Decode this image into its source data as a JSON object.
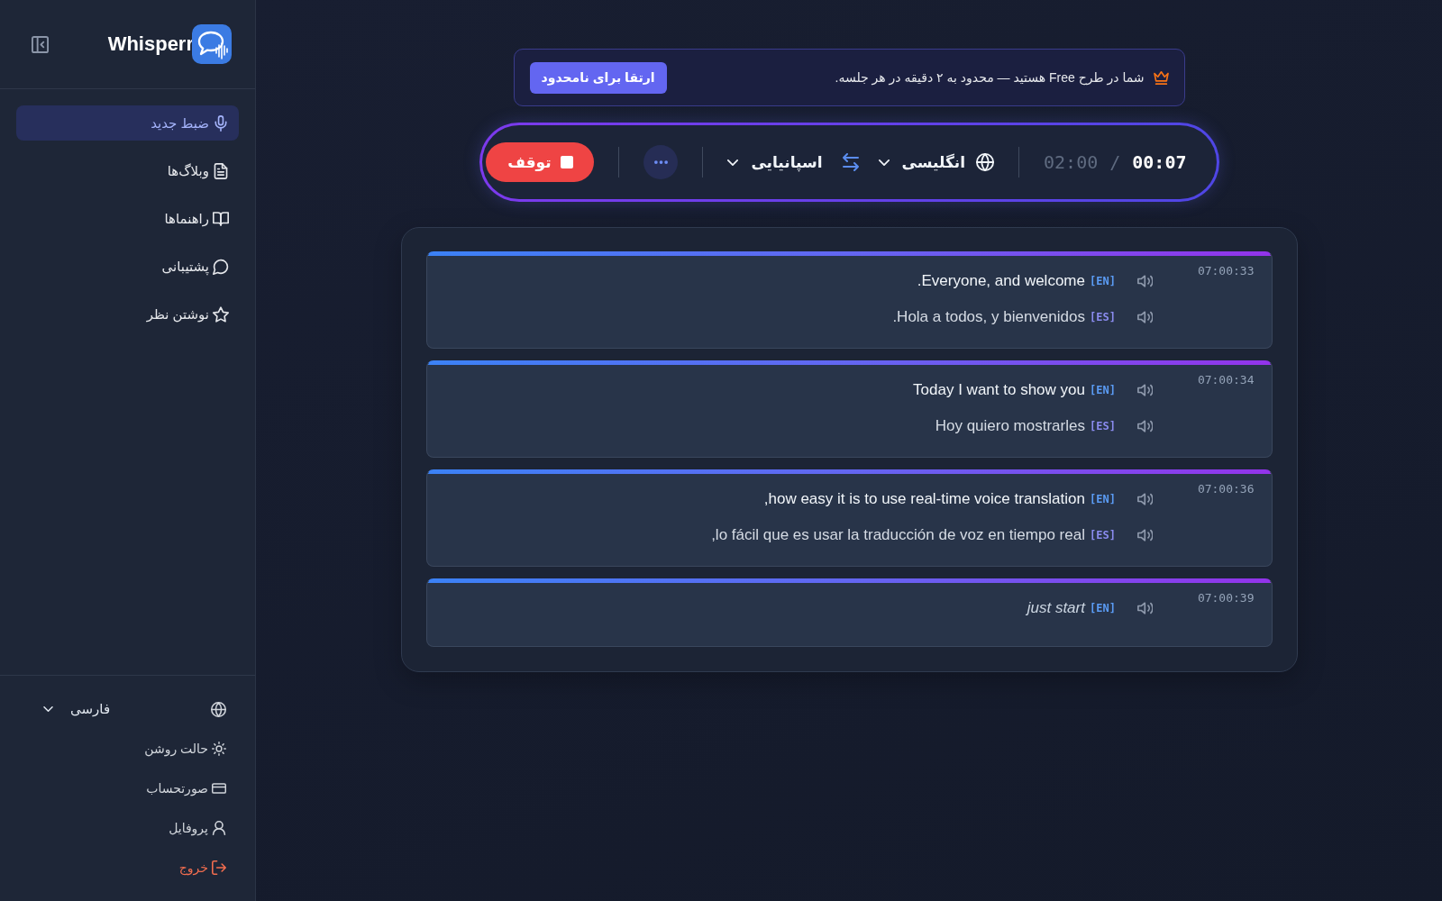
{
  "sidebar": {
    "logo_text": "Whisperr",
    "nav": [
      {
        "label": "ضبط جدید",
        "selected": true
      },
      {
        "label": "وبلاگ‌ها",
        "selected": false
      },
      {
        "label": "راهنماها",
        "selected": false
      },
      {
        "label": "پشتیبانی",
        "selected": false
      },
      {
        "label": "نوشتن نظر",
        "selected": false
      }
    ],
    "language": "فارسی",
    "footer": [
      {
        "label": "حالت روشن",
        "kind": "normal"
      },
      {
        "label": "صورتحساب",
        "kind": "normal"
      },
      {
        "label": "پروفایل",
        "kind": "normal"
      },
      {
        "label": "خروج",
        "kind": "danger"
      }
    ]
  },
  "banner": {
    "text": "شما در طرح Free هستید — محدود به ۲ دقیقه در هر جلسه.",
    "button": "ارتقا برای نامحدود"
  },
  "recorder": {
    "elapsed": "00:07",
    "separator": "/",
    "limit": "02:00",
    "source_language": "انگلیسی",
    "target_language": "اسپانیایی",
    "stop_button": "توقف"
  },
  "transcript": [
    {
      "time": "07:00:33",
      "lines": [
        {
          "kind": "source",
          "code": "[EN]",
          "text": ".Everyone, and welcome"
        },
        {
          "kind": "translation",
          "code": "[ES]",
          "text": ".Hola a todos, y bienvenidos"
        }
      ]
    },
    {
      "time": "07:00:34",
      "lines": [
        {
          "kind": "source",
          "code": "[EN]",
          "text": "Today I want to show you"
        },
        {
          "kind": "translation",
          "code": "[ES]",
          "text": "Hoy quiero mostrarles"
        }
      ]
    },
    {
      "time": "07:00:36",
      "lines": [
        {
          "kind": "source",
          "code": "[EN]",
          "text": ",how easy it is to use real-time voice translation"
        },
        {
          "kind": "translation",
          "code": "[ES]",
          "text": ",lo fácil que es usar la traducción de voz en tiempo real"
        }
      ]
    },
    {
      "time": "07:00:39",
      "lines": [
        {
          "kind": "interim",
          "code": "[EN]",
          "text": "just start"
        }
      ]
    }
  ]
}
